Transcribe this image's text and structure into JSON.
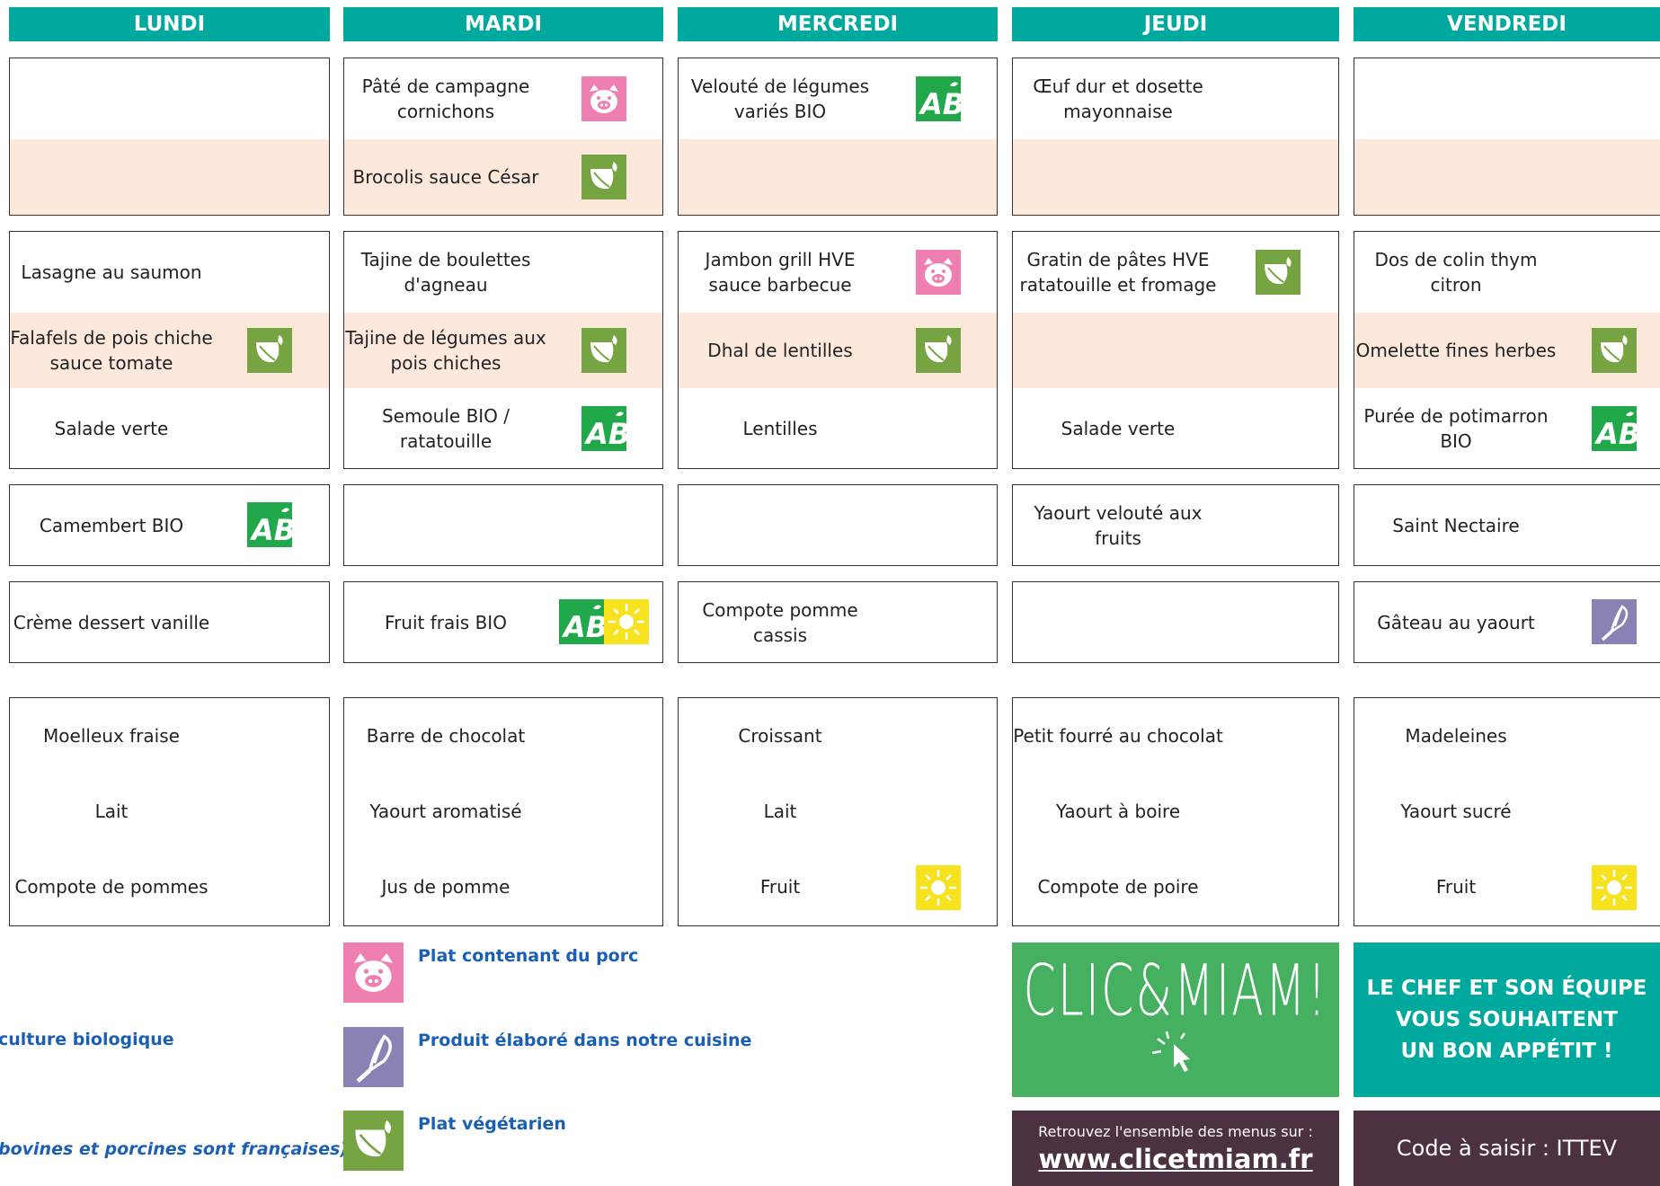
{
  "days": [
    "LUNDI",
    "MARDI",
    "MERCREDI",
    "JEUDI",
    "VENDREDI"
  ],
  "colors": {
    "header": "#00a99d",
    "accent_band": "#fde9dc",
    "pork": "#f07fb1",
    "bio": "#21a84a",
    "veg": "#76a442",
    "homemade": "#8a82b4",
    "local": "#f7e21f",
    "clicmiam_green": "#46b061",
    "dark_plum": "#4c3240"
  },
  "menu": {
    "lundi": {
      "starter": {
        "main": "",
        "alt": ""
      },
      "main_dish": {
        "main": "Lasagne au saumon",
        "alt": "Falafels de pois chiche sauce tomate",
        "side": "Salade verte"
      },
      "dairy": "Camembert BIO",
      "dessert": "Crème dessert vanille",
      "snack": [
        "Moelleux fraise",
        "Lait",
        "Compote de pommes"
      ]
    },
    "mardi": {
      "starter": {
        "main": "Pâté de campagne cornichons",
        "alt": "Brocolis sauce César"
      },
      "main_dish": {
        "main": "Tajine de boulettes d'agneau",
        "alt": "Tajine de légumes aux pois chiches",
        "side": "Semoule BIO / ratatouille"
      },
      "dairy": "",
      "dessert": "Fruit frais BIO",
      "snack": [
        "Barre de chocolat",
        "Yaourt aromatisé",
        "Jus de pomme"
      ]
    },
    "mercredi": {
      "starter": {
        "main": "Velouté de légumes variés BIO",
        "alt": ""
      },
      "main_dish": {
        "main": "Jambon grill HVE sauce barbecue",
        "alt": "Dhal de lentilles",
        "side": "Lentilles"
      },
      "dairy": "",
      "dessert": "Compote pomme cassis",
      "snack": [
        "Croissant",
        "Lait",
        "Fruit"
      ]
    },
    "jeudi": {
      "starter": {
        "main": "Œuf dur et dosette mayonnaise",
        "alt": ""
      },
      "main_dish": {
        "main": "Gratin de pâtes HVE ratatouille et fromage",
        "alt": "",
        "side": "Salade verte"
      },
      "dairy": "Yaourt velouté aux fruits",
      "dessert": "",
      "snack": [
        "Petit fourré au chocolat",
        "Yaourt à boire",
        "Compote de poire"
      ]
    },
    "vendredi": {
      "starter": {
        "main": "",
        "alt": ""
      },
      "main_dish": {
        "main": "Dos de colin thym citron",
        "alt": "Omelette fines herbes",
        "side": "Purée de potimarron BIO"
      },
      "dairy": "Saint Nectaire",
      "dessert": "Gâteau au yaourt",
      "snack": [
        "Madeleines",
        "Yaourt sucré",
        "Fruit"
      ]
    }
  },
  "legend": {
    "pork": "Plat contenant du porc",
    "homemade": "Produit élaboré dans notre cuisine",
    "vegetarian": "Plat végétarien",
    "bio": "culture biologique",
    "origin": "bovines et porcines sont françaises)"
  },
  "icons": [
    "pig-icon",
    "ab-bio-icon",
    "leaf-icon",
    "sun-icon",
    "whisk-icon",
    "cursor-icon"
  ],
  "clicmiam": {
    "logo": "CLIC&MIAM!",
    "find_label": "Retrouvez l'ensemble des menus sur :",
    "url": "www.clicetmiam.fr",
    "code": "Code à saisir : ITTEV"
  },
  "wish": [
    "LE CHEF ET SON ÉQUIPE",
    "VOUS SOUHAITENT",
    "UN BON APPÉTIT !"
  ]
}
